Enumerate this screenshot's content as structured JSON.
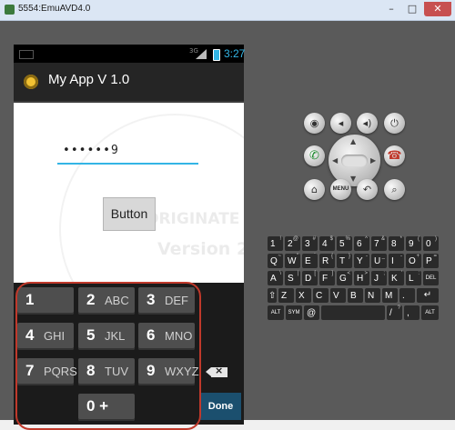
{
  "window": {
    "title": "5554:EmuAVD4.0",
    "minimize": "–",
    "maximize": "□",
    "close": "✕"
  },
  "status_bar": {
    "time": "3:27",
    "signal": "3G"
  },
  "action_bar": {
    "title": "My App V 1.0"
  },
  "password_field": {
    "value": "••••••9"
  },
  "button": {
    "label": "Button"
  },
  "watermark": {
    "line1": "ORIGINATE",
    "line2": "Version 2"
  },
  "keypad": {
    "keys": [
      {
        "num": "1",
        "letters": ""
      },
      {
        "num": "2",
        "letters": "ABC"
      },
      {
        "num": "3",
        "letters": "DEF"
      },
      {
        "num": "4",
        "letters": "GHI"
      },
      {
        "num": "5",
        "letters": "JKL"
      },
      {
        "num": "6",
        "letters": "MNO"
      },
      {
        "num": "7",
        "letters": "PQRS"
      },
      {
        "num": "8",
        "letters": "TUV"
      },
      {
        "num": "9",
        "letters": "WXYZ"
      },
      {
        "num": "0 +",
        "letters": ""
      }
    ],
    "done_label": "Done",
    "backspace_icon": "backspace-icon"
  },
  "emulator_controls": {
    "top_row_icons": [
      "camera-icon",
      "volume-down-icon",
      "volume-up-icon",
      "power-icon"
    ],
    "call_icon": "call-icon",
    "end_call_icon": "end-call-icon",
    "bottom_row_icons": [
      "home-icon",
      "menu-icon",
      "back-icon",
      "search-icon"
    ],
    "menu_label": "MENU"
  },
  "qwerty": {
    "rows": [
      [
        [
          "1",
          "!"
        ],
        [
          "2",
          "@"
        ],
        [
          "3",
          "#"
        ],
        [
          "4",
          "$"
        ],
        [
          "5",
          "%"
        ],
        [
          "6",
          "^"
        ],
        [
          "7",
          "&"
        ],
        [
          "8",
          "*"
        ],
        [
          "9",
          "("
        ],
        [
          "0",
          ")"
        ]
      ],
      [
        [
          "Q",
          "~"
        ],
        [
          "W",
          "\""
        ],
        [
          "E",
          "`"
        ],
        [
          "R",
          "{"
        ],
        [
          "T",
          "}"
        ],
        [
          "Y",
          "-"
        ],
        [
          "U",
          "_"
        ],
        [
          "I",
          "-"
        ],
        [
          "O",
          "+"
        ],
        [
          "P",
          "="
        ]
      ],
      [
        [
          "A",
          "\\"
        ],
        [
          "S",
          "|"
        ],
        [
          "D",
          "["
        ],
        [
          "F",
          "]"
        ],
        [
          "G",
          "<"
        ],
        [
          "H",
          ">"
        ],
        [
          "J",
          ";"
        ],
        [
          "K",
          "'"
        ],
        [
          "L",
          ":"
        ]
      ],
      [
        [
          "Z",
          ""
        ],
        [
          "X",
          ""
        ],
        [
          "C",
          ""
        ],
        [
          "V",
          ""
        ],
        [
          "B",
          ""
        ],
        [
          "N",
          ""
        ],
        [
          "M",
          ""
        ],
        [
          ".",
          ""
        ]
      ],
      [
        [
          "ALT",
          ""
        ],
        [
          "SYM",
          ""
        ],
        [
          "@",
          ""
        ],
        [
          "",
          ""
        ],
        [
          "/",
          "?"
        ],
        [
          ",",
          ""
        ],
        [
          "ALT",
          ""
        ]
      ]
    ],
    "del_label": "DEL"
  }
}
